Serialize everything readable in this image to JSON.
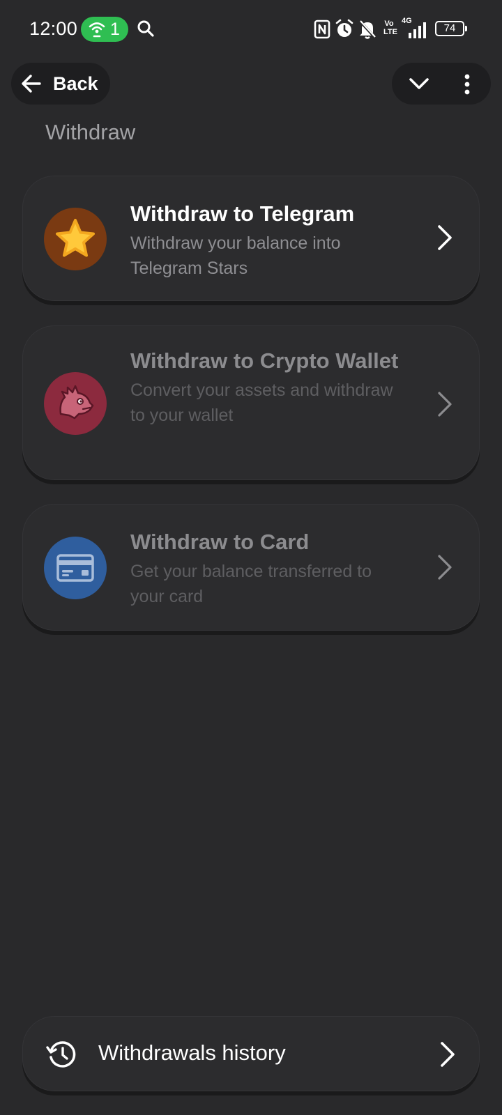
{
  "status_bar": {
    "time": "12:00",
    "hotspot_count": "1",
    "network_type": "4G",
    "volte_label": "Vo LTE",
    "battery_level": "74",
    "icons": [
      "hotspot-icon",
      "search-icon",
      "nfc-icon",
      "alarm-icon",
      "bell-off-icon",
      "signal-icon",
      "battery-icon"
    ],
    "hotspot_color": "#2fbe52"
  },
  "nav": {
    "back_label": "Back",
    "icons": [
      "arrow-left-icon",
      "chevron-down-icon",
      "more-vertical-icon"
    ]
  },
  "page": {
    "title": "Withdraw"
  },
  "options": [
    {
      "title": "Withdraw to Telegram",
      "subtitle": "Withdraw your balance into Telegram Stars",
      "icon": "star-icon",
      "accent": "#7a3a12",
      "enabled": true
    },
    {
      "title": "Withdraw to Crypto Wallet",
      "subtitle": "Convert your assets and withdraw to your wallet",
      "icon": "dragon-icon",
      "accent": "#8c2a3e",
      "enabled": false
    },
    {
      "title": "Withdraw to Card",
      "subtitle": "Get your balance transferred to your card",
      "icon": "credit-card-icon",
      "accent": "#2f5e9e",
      "enabled": false
    }
  ],
  "history": {
    "label": "Withdrawals history",
    "icon": "history-icon"
  },
  "colors": {
    "background": "#29292b",
    "card": "#2c2c2e",
    "text_primary": "#ffffff",
    "text_secondary": "#8e8e92"
  }
}
